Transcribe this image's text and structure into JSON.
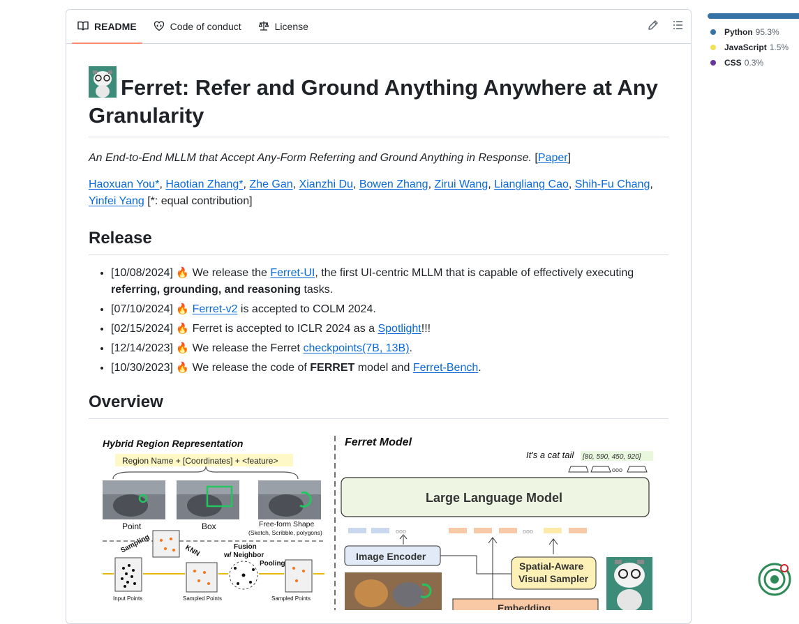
{
  "tabs": [
    {
      "label": "README",
      "icon": "book-icon",
      "active": true
    },
    {
      "label": "Code of conduct",
      "icon": "heart-code-icon",
      "active": false
    },
    {
      "label": "License",
      "icon": "law-scale-icon",
      "active": false
    }
  ],
  "readme": {
    "title": "Ferret: Refer and Ground Anything Anywhere at Any Granularity",
    "tagline": "An End-to-End MLLM that Accept Any-Form Referring and Ground Anything in Response.",
    "paper_link": "Paper",
    "authors": [
      "Haoxuan You*",
      "Haotian Zhang*",
      "Zhe Gan",
      "Xianzhi Du",
      "Bowen Zhang",
      "Zirui Wang",
      "Liangliang Cao",
      "Shih-Fu Chang",
      "Yinfei Yang"
    ],
    "contribution_note": "[*: equal contribution]",
    "release_heading": "Release",
    "releases": [
      {
        "date": "[10/08/2024]",
        "pre": "We release the ",
        "link": "Ferret-UI",
        "post": ", the first UI-centric MLLM that is capable of effectively executing ",
        "bold": "referring, grounding, and reasoning",
        "post2": " tasks."
      },
      {
        "date": "[07/10/2024]",
        "pre": "",
        "link": "Ferret-v2",
        "post": " is accepted to COLM 2024."
      },
      {
        "date": "[02/15/2024]",
        "pre": "Ferret is accepted to ICLR 2024 as a ",
        "link": "Spotlight",
        "post": "!!!"
      },
      {
        "date": "[12/14/2023]",
        "pre": "We release the Ferret ",
        "link": "checkpoints(7B, 13B)",
        "post": "."
      },
      {
        "date": "[10/30/2023]",
        "pre": "We release the code of ",
        "bold": "FERRET",
        "mid": " model and ",
        "link": "Ferret-Bench",
        "post": "."
      }
    ],
    "overview_heading": "Overview",
    "figure": {
      "left_title": "Hybrid Region Representation",
      "formula": "Region Name + [Coordinates] + <feature>",
      "thumb_labels": [
        "Point",
        "Box",
        "Free-form Shape"
      ],
      "freeform_sub": "(Sketch, Scribble, polygons)",
      "right_title": "Ferret Model",
      "output_text": "It's a cat tail",
      "output_coords": "[80, 590, 450, 920]",
      "llm_label": "Large Language Model",
      "encoder_label": "Image Encoder",
      "sampler_label_1": "Spatial-Aware",
      "sampler_label_2": "Visual Sampler",
      "embedding_label": "Embedding",
      "sampling_label": "Sampling",
      "knn_label": "KNN",
      "fusion_label_1": "Fusion",
      "fusion_label_2": "w/ Neighbor",
      "pooling_label": "Pooling",
      "input_points": "Input Points",
      "sampled_points": "Sampled Points",
      "sampled_points_out": "Sampled Points"
    }
  },
  "languages": [
    {
      "name": "Python",
      "pct": "95.3%",
      "color": "#3572A5"
    },
    {
      "name": "JavaScript",
      "pct": "1.5%",
      "color": "#f1e05a"
    },
    {
      "name": "CSS",
      "pct": "0.3%",
      "color": "#663399"
    }
  ]
}
